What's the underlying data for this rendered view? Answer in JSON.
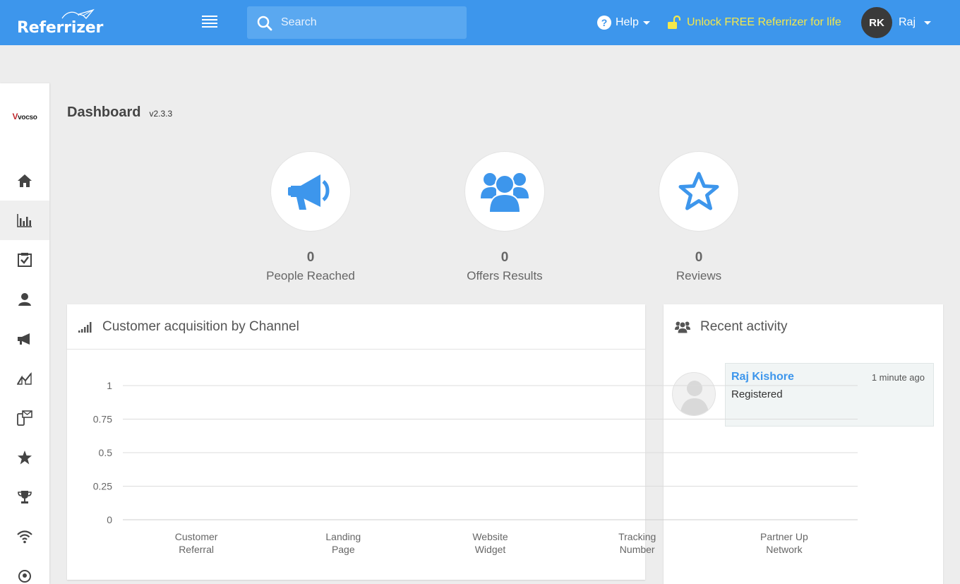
{
  "app": {
    "logo": "Referrizer",
    "search_placeholder": "Search",
    "help_label": "Help",
    "unlock_label": "Unlock FREE Referrizer for life",
    "user_initials": "RK",
    "user_name": "Raj"
  },
  "colors": {
    "topbar": "#3d96ec",
    "accent": "#3d96ec",
    "unlock": "#f5e84a"
  },
  "sidebar": {
    "brand": "vocso",
    "items": [
      {
        "icon": "home-icon"
      },
      {
        "icon": "bar-chart-icon",
        "active": true
      },
      {
        "icon": "checklist-icon"
      },
      {
        "icon": "customers-icon"
      },
      {
        "icon": "megaphone-icon"
      },
      {
        "icon": "analytics-icon"
      },
      {
        "icon": "messaging-icon"
      },
      {
        "icon": "star-icon"
      },
      {
        "icon": "trophy-icon"
      },
      {
        "icon": "wifi-icon"
      },
      {
        "icon": "support-icon"
      }
    ]
  },
  "page": {
    "title": "Dashboard",
    "version": "v2.3.3"
  },
  "stats": [
    {
      "icon": "megaphone-icon",
      "value": "0",
      "label": "People Reached"
    },
    {
      "icon": "users-icon",
      "value": "0",
      "label": "Offers Results"
    },
    {
      "icon": "star-outline-icon",
      "value": "0",
      "label": "Reviews"
    }
  ],
  "chart_panel": {
    "title": "Customer acquisition by Channel"
  },
  "chart_data": {
    "type": "bar",
    "title": "Customer acquisition by Channel",
    "categories": [
      "Customer Referral",
      "Landing Page",
      "Website Widget",
      "Tracking Number",
      "Partner Up Network"
    ],
    "category_lines": [
      [
        "Customer",
        "Referral"
      ],
      [
        "Landing",
        "Page"
      ],
      [
        "Website",
        "Widget"
      ],
      [
        "Tracking",
        "Number"
      ],
      [
        "Partner Up",
        "Network"
      ]
    ],
    "values": [
      0,
      0,
      0,
      0,
      0
    ],
    "yticks": [
      "0",
      "0.25",
      "0.5",
      "0.75",
      "1"
    ],
    "ylim": [
      0,
      1
    ],
    "grid": true
  },
  "activity": {
    "title": "Recent activity",
    "items": [
      {
        "name": "Raj Kishore",
        "time": "1 minute ago",
        "text": "Registered"
      }
    ]
  }
}
